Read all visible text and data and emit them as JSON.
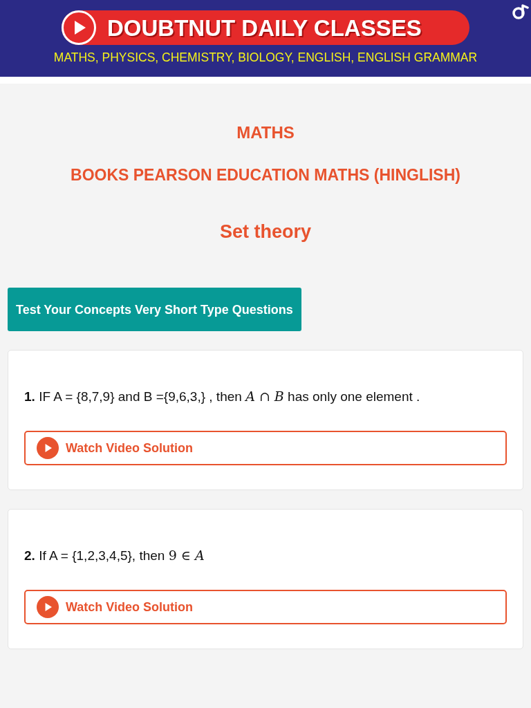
{
  "banner": {
    "title": "DOUBTNUT DAILY CLASSES",
    "subtitle": "MATHS, PHYSICS, CHEMISTRY, BIOLOGY, ENGLISH, ENGLISH GRAMMAR"
  },
  "headings": [
    {
      "kind": "subject",
      "text": "MATHS"
    },
    {
      "kind": "book",
      "text": "BOOKS PEARSON EDUCATION MATHS (HINGLISH)"
    },
    {
      "kind": "chapter",
      "text": "Set theory"
    }
  ],
  "section_button": {
    "label": "Test Your Concepts Very Short Type Questions"
  },
  "questions": [
    {
      "number": "1.",
      "parts": [
        {
          "kind": "text",
          "text": "IF A = {8,7,9} and B ={9,6,3,} , then"
        },
        {
          "kind": "math",
          "text": "*A* ∩ *B*"
        },
        {
          "kind": "text",
          "text": "has only one element ."
        }
      ],
      "button": "Watch Video Solution"
    },
    {
      "number": "2.",
      "parts": [
        {
          "kind": "text",
          "text": "If A = {1,2,3,4,5}, then"
        },
        {
          "kind": "math",
          "text": "9 ∈ *A*"
        }
      ],
      "button": "Watch Video Solution"
    }
  ]
}
